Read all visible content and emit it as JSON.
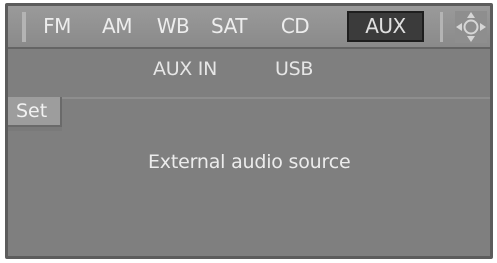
{
  "source_bar": {
    "tabs": [
      {
        "id": "fm",
        "label": "FM"
      },
      {
        "id": "am",
        "label": "AM"
      },
      {
        "id": "wb",
        "label": "WB"
      },
      {
        "id": "sat",
        "label": "SAT"
      },
      {
        "id": "cd",
        "label": "CD"
      },
      {
        "id": "aux",
        "label": "AUX",
        "selected": true
      }
    ],
    "controller_icon": "controller-direction-icon"
  },
  "sub_bar": {
    "items": [
      {
        "label": "AUX IN"
      },
      {
        "label": "USB"
      }
    ]
  },
  "menu": {
    "set_label": "Set"
  },
  "main": {
    "info_text": "External audio source"
  },
  "colors": {
    "background": "#7f7f7f",
    "bar": "#9a9a9a",
    "selected_tab": "#3b3b3b",
    "text": "#ededed"
  }
}
